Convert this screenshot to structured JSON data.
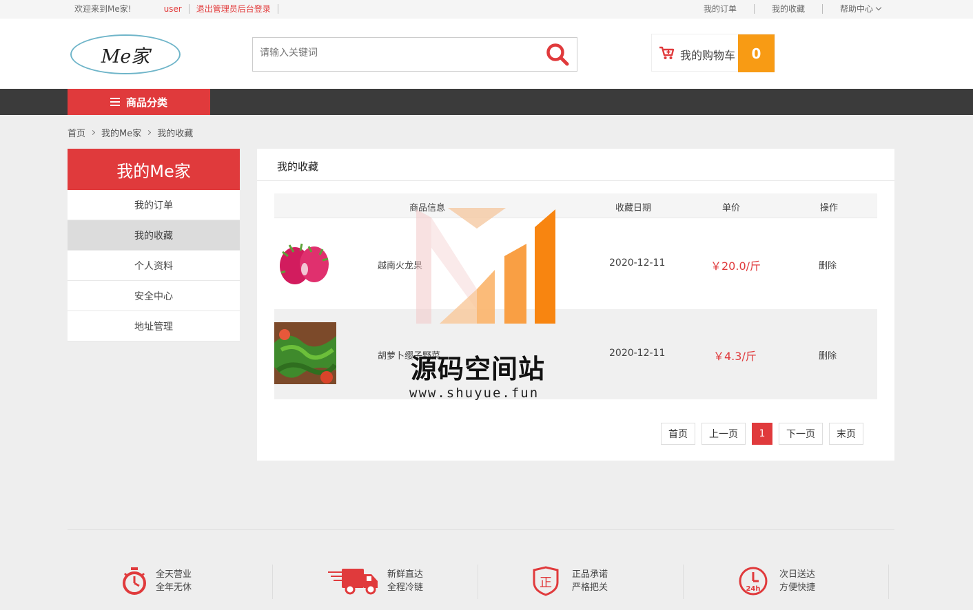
{
  "topbar": {
    "welcome": "欢迎来到Me家!",
    "user": "user",
    "logout": "退出管理员后台登录",
    "orders": "我的订单",
    "favorites": "我的收藏",
    "help": "帮助中心"
  },
  "header": {
    "logo": "Me家",
    "search_placeholder": "请输入关键词",
    "cart_label": "我的购物车",
    "cart_count": "0"
  },
  "nav": {
    "category": "商品分类"
  },
  "breadcrumb": [
    "首页",
    "我的Me家",
    "我的收藏"
  ],
  "sidebar": {
    "title": "我的Me家",
    "items": [
      "我的订单",
      "我的收藏",
      "个人资料",
      "安全中心",
      "地址管理"
    ],
    "active_index": 1
  },
  "panel": {
    "title": "我的收藏",
    "columns": [
      "商品信息",
      "收藏日期",
      "单价",
      "操作"
    ],
    "rows": [
      {
        "name": "越南火龙果",
        "date": "2020-12-11",
        "price": "￥20.0/斤",
        "action": "删除"
      },
      {
        "name": "胡萝卜缨子野菜",
        "date": "2020-12-11",
        "price": "￥4.3/斤",
        "action": "删除"
      }
    ],
    "pager": {
      "first": "首页",
      "prev": "上一页",
      "current": "1",
      "next": "下一页",
      "last": "末页"
    }
  },
  "watermark": {
    "text": "源码空间站",
    "url": "www.shuyue.fun"
  },
  "footer": {
    "features": [
      {
        "icon": "stopwatch-icon",
        "line1": "全天营业",
        "line2": "全年无休"
      },
      {
        "icon": "delivery-truck-icon",
        "line1": "新鲜直达",
        "line2": "全程冷链"
      },
      {
        "icon": "shield-icon",
        "line1": "正品承诺",
        "line2": "严格把关",
        "badge": "正"
      },
      {
        "icon": "clock-24h-icon",
        "line1": "次日送达",
        "line2": "方便快捷",
        "badge": "24h"
      }
    ]
  },
  "colors": {
    "brand_red": "#e03a3c",
    "cart_orange": "#f89b14",
    "nav_dark": "#3b3b3b"
  }
}
